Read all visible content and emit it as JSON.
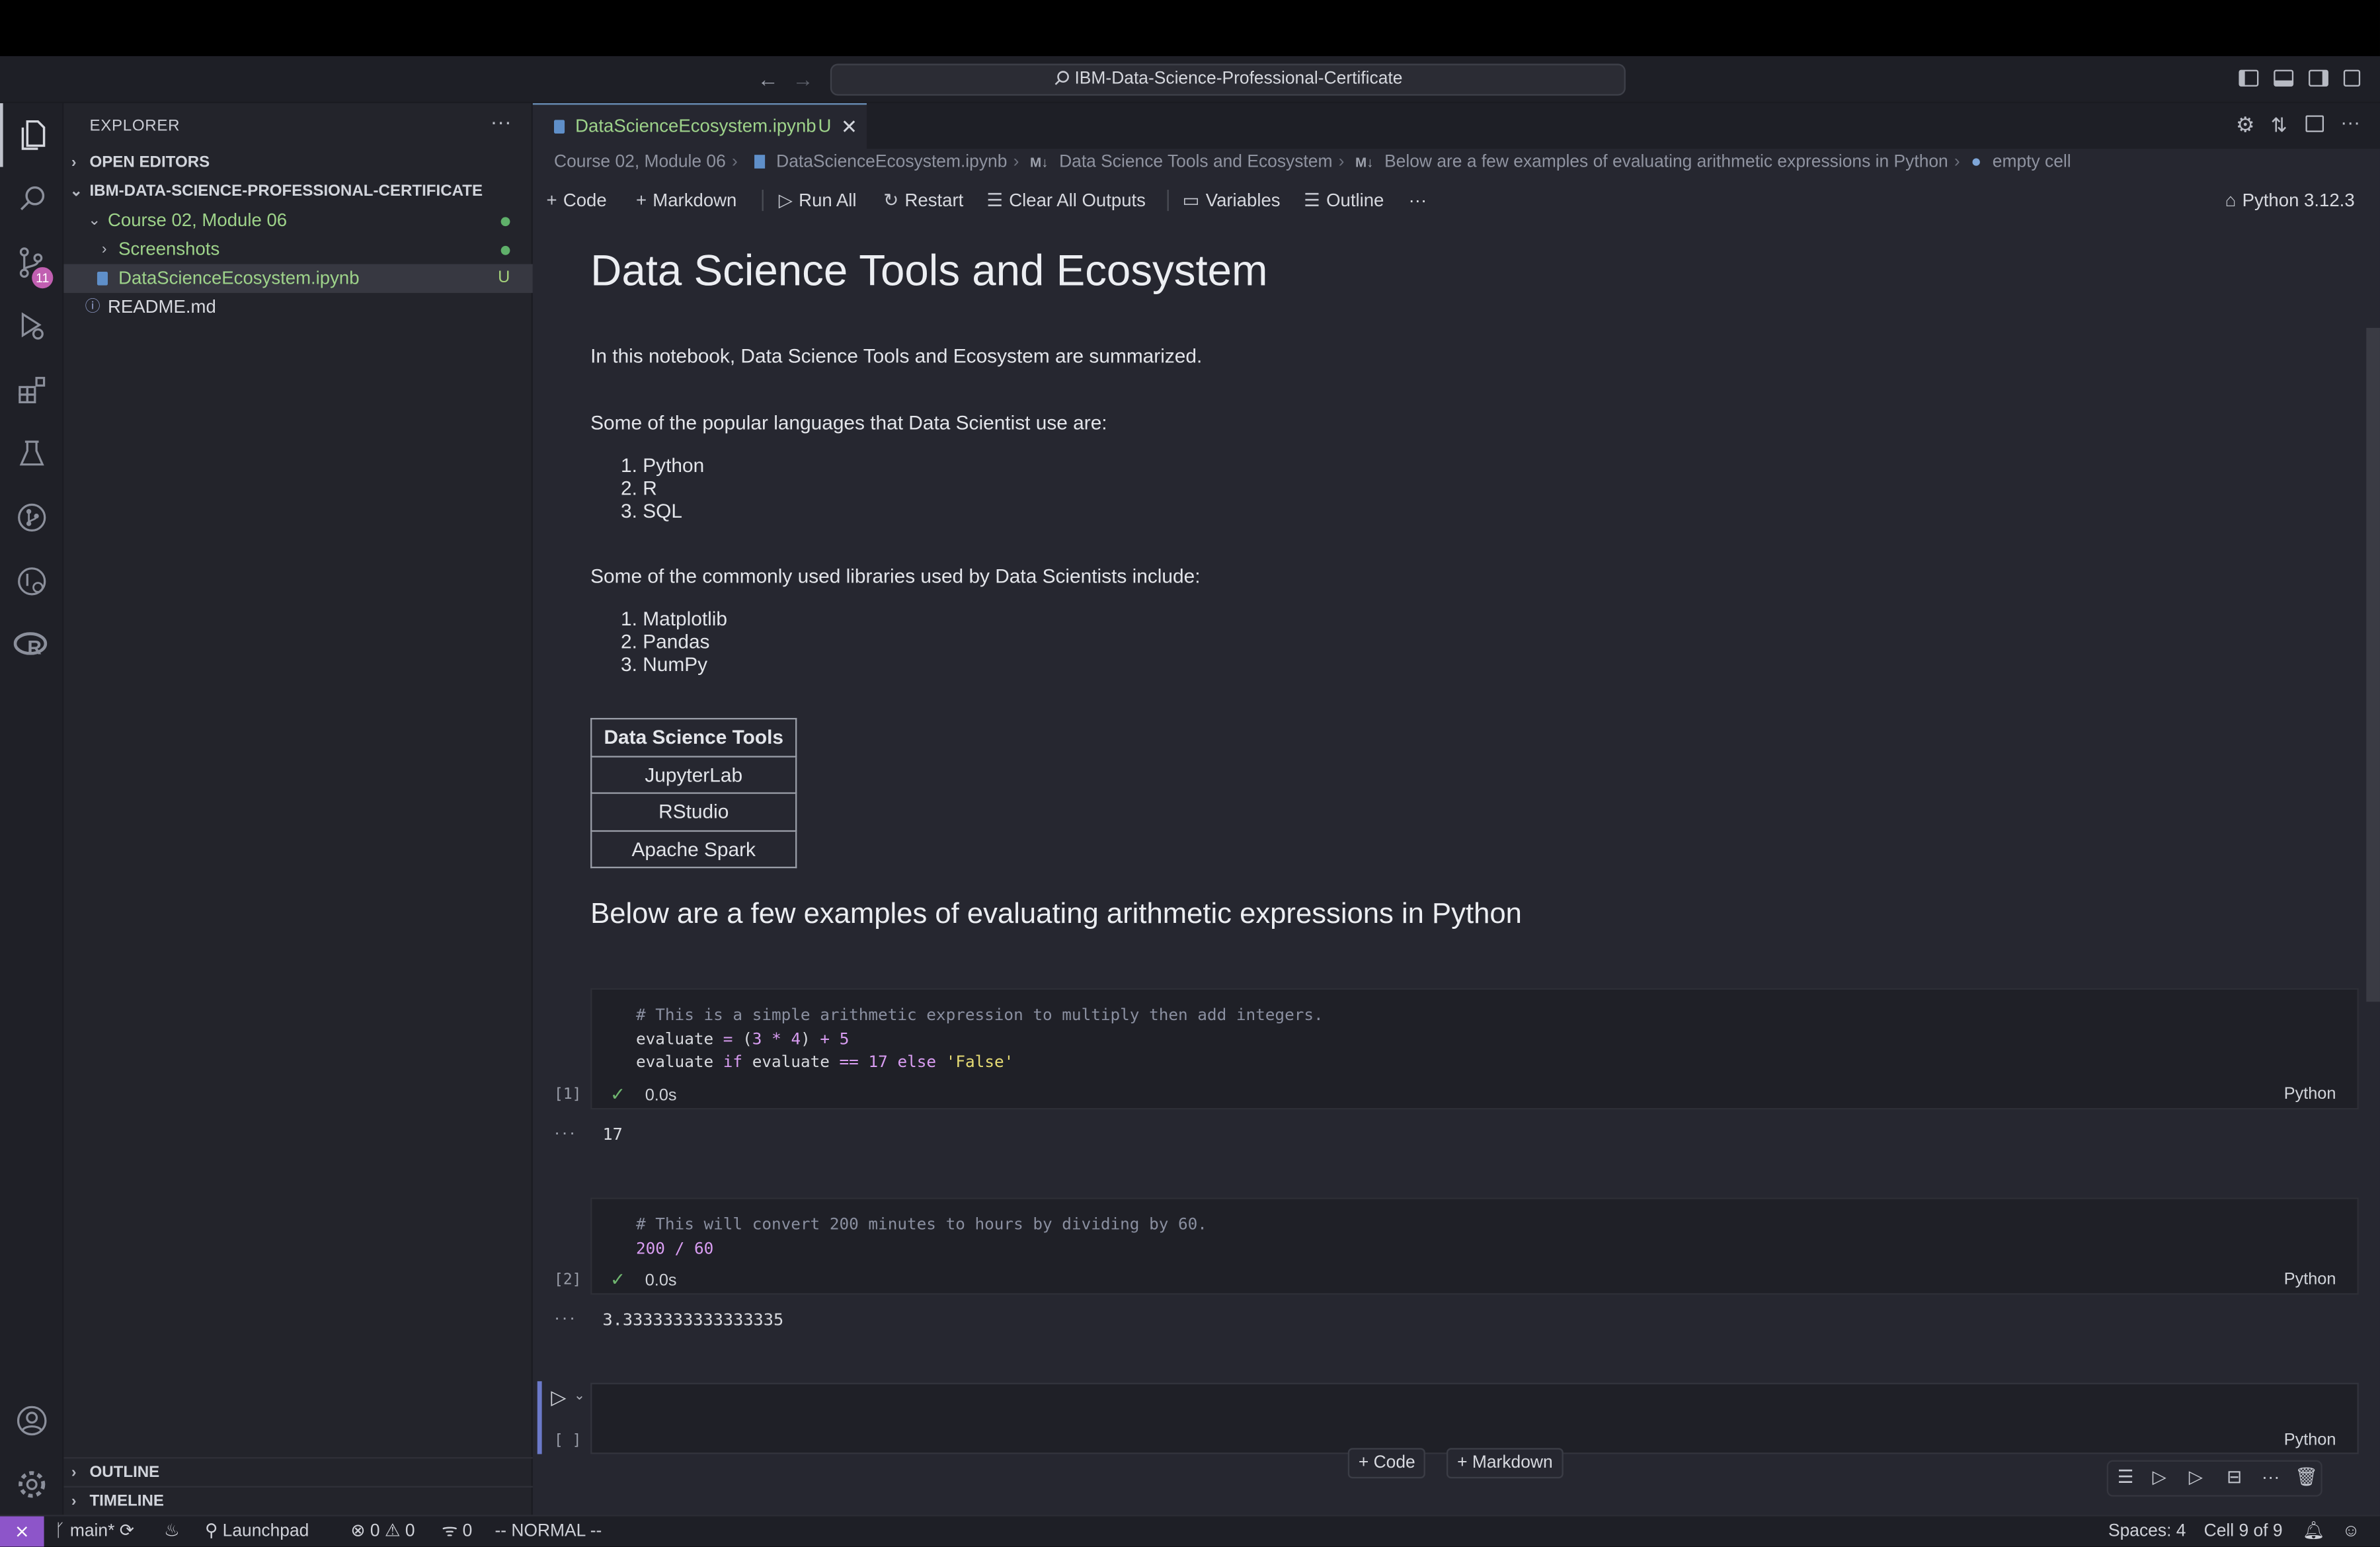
{
  "titlebar": {
    "search_text": "IBM-Data-Science-Professional-Certificate"
  },
  "activity_bar": {
    "scm_badge": "11"
  },
  "explorer": {
    "title": "EXPLORER",
    "more": "···",
    "open_editors": "OPEN EDITORS",
    "root": "IBM-DATA-SCIENCE-PROFESSIONAL-CERTIFICATE",
    "items": [
      {
        "label": "Course 02, Module 06",
        "color": "#9ed38a"
      },
      {
        "label": "Screenshots",
        "color": "#9ed38a"
      },
      {
        "label": "DataScienceEcosystem.ipynb",
        "badge": "U",
        "color": "#9ed38a"
      },
      {
        "label": "README.md",
        "color": "#d7d9df"
      }
    ],
    "outline": "OUTLINE",
    "timeline": "TIMELINE"
  },
  "tab": {
    "label": "DataScienceEcosystem.ipynb",
    "badge": "U"
  },
  "breadcrumb": [
    "Course 02, Module 06",
    "DataScienceEcosystem.ipynb",
    "Data Science Tools and Ecosystem",
    "Below are a few examples of evaluating arithmetic expressions in Python",
    "empty cell"
  ],
  "toolbar": {
    "code": "Code",
    "markdown": "Markdown",
    "run_all": "Run All",
    "restart": "Restart",
    "clear_outputs": "Clear All Outputs",
    "variables": "Variables",
    "outline": "Outline",
    "more": "···",
    "kernel": "Python 3.12.3"
  },
  "notebook": {
    "title": "Data Science Tools and Ecosystem",
    "intro": "In this notebook, Data Science Tools and Ecosystem are summarized.",
    "languages_heading": "Some of the popular languages that Data Scientist use are:",
    "languages": [
      "Python",
      "R",
      "SQL"
    ],
    "libraries_heading": "Some of the commonly used libraries used by Data Scientists include:",
    "libraries": [
      "Matplotlib",
      "Pandas",
      "NumPy"
    ],
    "table_header": "Data Science Tools",
    "table_rows": [
      "JupyterLab",
      "RStudio",
      "Apache Spark"
    ],
    "section_heading": "Below are a few examples of evaluating arithmetic expressions in Python",
    "cell1": {
      "comment": "# This is a simple arithmetic expression to multiply then add integers.",
      "line2": "evaluate = (3 * 4) + 5",
      "line3": "evaluate if evaluate == 17 else 'False'",
      "exec": "[1]",
      "duration": "0.0s",
      "lang": "Python",
      "output": "17"
    },
    "cell2": {
      "comment": "# This will convert 200 minutes to hours by dividing by 60.",
      "line2": "200 / 60",
      "exec": "[2]",
      "duration": "0.0s",
      "lang": "Python",
      "output": "3.3333333333333335"
    },
    "cell3": {
      "exec": "[ ]",
      "lang": "Python"
    },
    "add_code": "Code",
    "add_markdown": "Markdown"
  },
  "status": {
    "branch": "main*",
    "launchpad": "Launchpad",
    "errors": "0",
    "warnings": "0",
    "ports": "0",
    "mode": "-- NORMAL --",
    "spaces": "Spaces: 4",
    "cell": "Cell 9 of 9"
  }
}
